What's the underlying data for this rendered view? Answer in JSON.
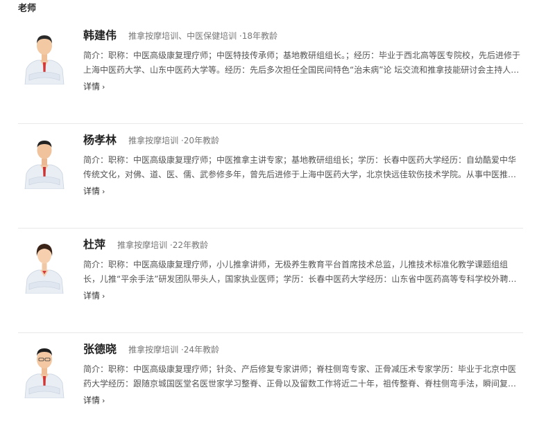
{
  "section": {
    "title": "老师"
  },
  "teachers": [
    {
      "name": "韩建伟",
      "meta": "推拿按摩培训、中医保健培训 ·18年教龄",
      "bio": "简介：职称：中医高级康复理疗师；中医特技传承师；基地教研组组长。；经历：毕业于西北高等医专院校，先后进修于上海中医药大学、山东中医药大学等。经历：先后多次担任全国民间特色“治未病”论 坛交流和推拿技能研讨会主持人，并多次在全国推拿技能研讨会上作专题演讲。",
      "more_label": "详情",
      "hair": "#2a2a2a",
      "chevron": "›"
    },
    {
      "name": "杨孝林",
      "meta": "推拿按摩培训 ·20年教龄",
      "bio": "简介：职称：中医高级康复理疗师；中医推拿主讲专家；基地教研组组长；学历：长春中医药大学经历：自幼酷爱中华传统文化，对佛、道、医、儒、武参修多年，曾先后进修于上海中医药大学，北京快远佳软伤技术学院。从事中医推拿工作二十余年。",
      "more_label": "详情",
      "hair": "#222222",
      "chevron": "›"
    },
    {
      "name": "杜萍",
      "meta": "推拿按摩培训 ·22年教龄",
      "bio": "简介：职称：中医高级康复理疗师，小儿推拿讲师，无极养生教育平台首席技术总监，儿推技术标准化教学课题组组长，儿推“平余手法”研发团队带头人，国家执业医师；学历：长春中医药大学经历：山东省中医药高等专科学校外聘讲师。",
      "more_label": "详情",
      "hair": "#3a2418",
      "chevron": "›"
    },
    {
      "name": "张德晓",
      "meta": "推拿按摩培训 ·24年教龄",
      "bio": "简介：职称：中医高级康复理疗师；针灸、产后修复专家讲师；脊柱侧弯专家、正骨减压术专家学历：毕业于北京中医药大学经历：跟随京城国医堂名医世家学习整脊、正骨以及留数工作将近二十年，祖传整脊、脊柱侧弯手法，瞬间复位。",
      "more_label": "详情",
      "hair": "#1e1e1e",
      "chevron": "›"
    }
  ]
}
